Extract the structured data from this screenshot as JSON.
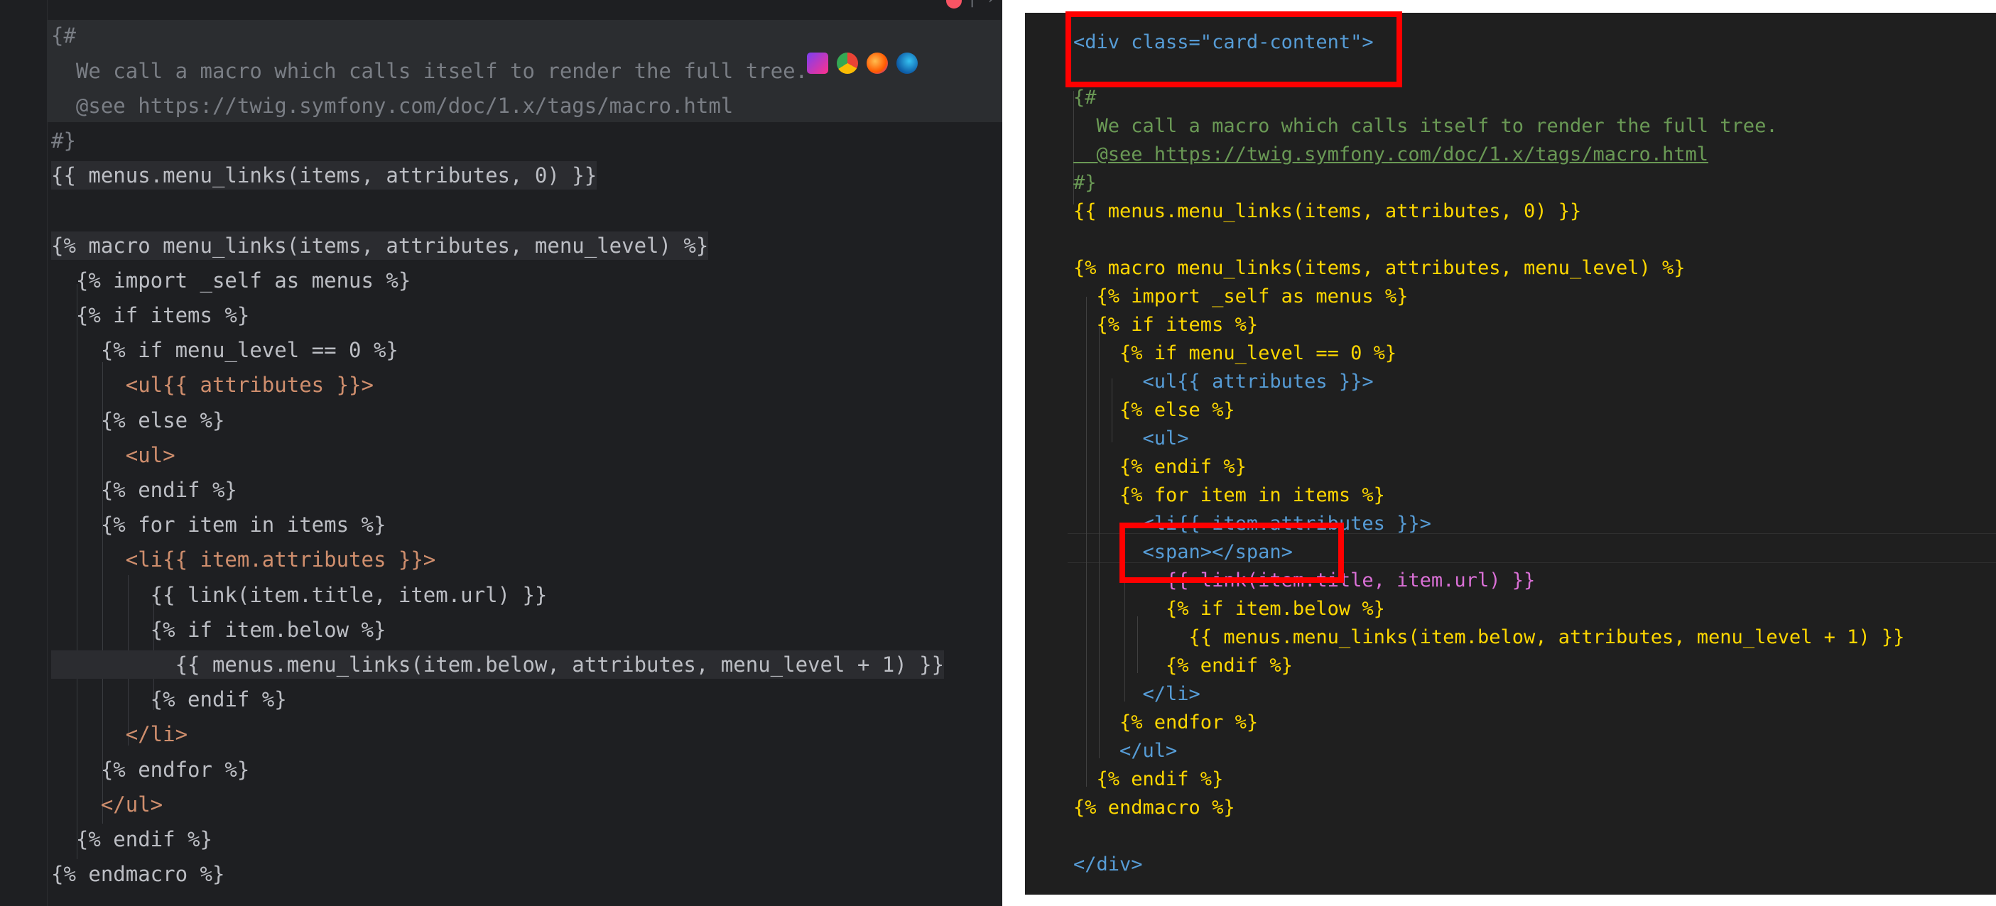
{
  "left_editor": {
    "lines": [
      "{#",
      "  We call a macro which calls itself to render the full tree.",
      "  @see https://twig.symfony.com/doc/1.x/tags/macro.html",
      "#}",
      "{{ menus.menu_links(items, attributes, 0) }}",
      "",
      "{% macro menu_links(items, attributes, menu_level) %}",
      "  {% import _self as menus %}",
      "  {% if items %}",
      "    {% if menu_level == 0 %}",
      "      <ul{{ attributes }}>",
      "    {% else %}",
      "      <ul>",
      "    {% endif %}",
      "    {% for item in items %}",
      "      <li{{ item.attributes }}>",
      "        {{ link(item.title, item.url) }}",
      "        {% if item.below %}",
      "          {{ menus.menu_links(item.below, attributes, menu_level + 1) }}",
      "        {% endif %}",
      "      </li>",
      "    {% endfor %}",
      "    </ul>",
      "  {% endif %}",
      "{% endmacro %}"
    ],
    "browser_icons": [
      "phpstorm-icon",
      "chrome-icon",
      "firefox-icon",
      "edge-icon"
    ]
  },
  "right_editor": {
    "open_div": "<div class=\"card-content\">",
    "lines": [
      "{#",
      "  We call a macro which calls itself to render the full tree.",
      "  @see https://twig.symfony.com/doc/1.x/tags/macro.html",
      "#}",
      "{{ menus.menu_links(items, attributes, 0) }}",
      "",
      "{% macro menu_links(items, attributes, menu_level) %}",
      "  {% import _self as menus %}",
      "  {% if items %}",
      "    {% if menu_level == 0 %}",
      "      <ul{{ attributes }}>",
      "    {% else %}",
      "      <ul>",
      "    {% endif %}",
      "    {% for item in items %}",
      "      <li{{ item.attributes }}>",
      "      <span></span>",
      "        {{ link(item.title, item.url) }}",
      "        {% if item.below %}",
      "          {{ menus.menu_links(item.below, attributes, menu_level + 1) }}",
      "        {% endif %}",
      "      </li>",
      "    {% endfor %}",
      "    </ul>",
      "  {% endif %}",
      "{% endmacro %}",
      "",
      "</div>"
    ]
  },
  "highlight_color": "#ff0000"
}
